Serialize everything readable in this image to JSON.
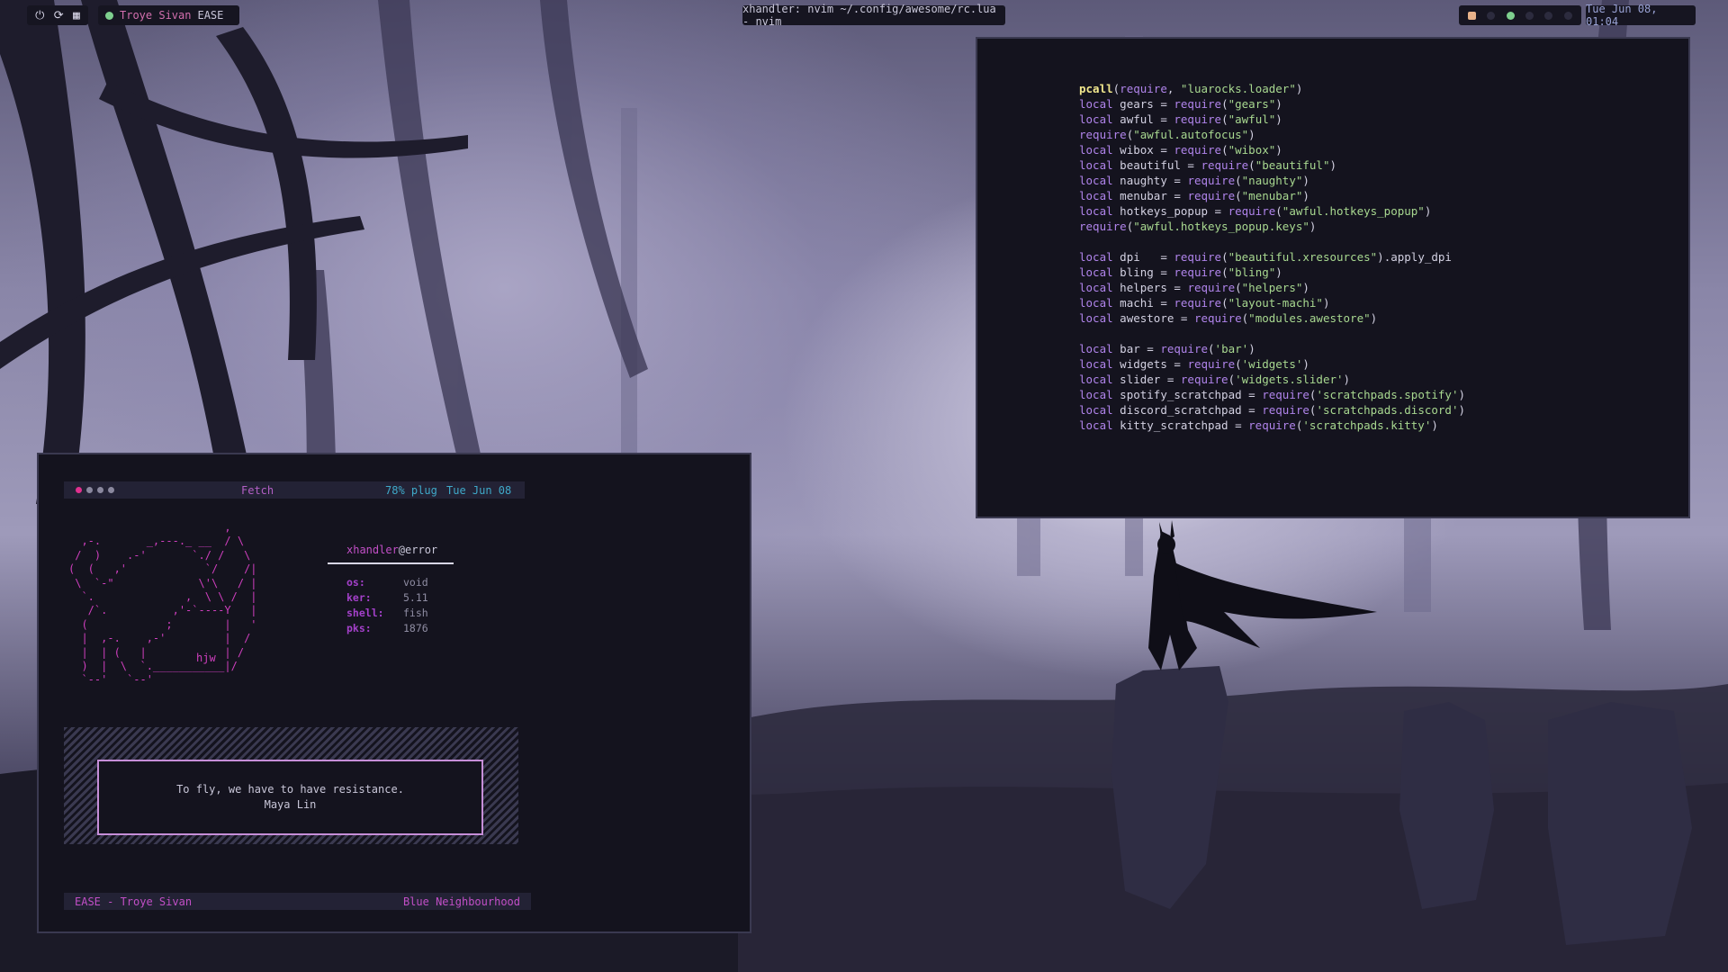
{
  "topbar": {
    "system_icons": [
      "power-icon",
      "reload-icon",
      "layout-icon"
    ],
    "music": {
      "title": "Troye Sivan",
      "song": "EASE"
    },
    "window_title": "xhandler: nvim ~/.config/awesome/rc.lua - nvim",
    "tray_icons": [
      "ghost-icon",
      "dot-icon",
      "spotify-icon",
      "dot-icon",
      "dot-icon",
      "dot-icon"
    ],
    "clock": "Tue Jun 08, 01:04"
  },
  "editor": {
    "lines": [
      [
        [
          "fn",
          "pcall"
        ],
        [
          "id",
          "("
        ],
        [
          "kw",
          "require"
        ],
        [
          "id",
          ", "
        ],
        [
          "str",
          "\"luarocks.loader\""
        ],
        [
          "id",
          ")"
        ]
      ],
      [
        [
          "kw",
          "local"
        ],
        [
          "id",
          " gears = "
        ],
        [
          "kw",
          "require"
        ],
        [
          "id",
          "("
        ],
        [
          "str",
          "\"gears\""
        ],
        [
          "id",
          ")"
        ]
      ],
      [
        [
          "kw",
          "local"
        ],
        [
          "id",
          " awful = "
        ],
        [
          "kw",
          "require"
        ],
        [
          "id",
          "("
        ],
        [
          "str",
          "\"awful\""
        ],
        [
          "id",
          ")"
        ]
      ],
      [
        [
          "kw",
          "require"
        ],
        [
          "id",
          "("
        ],
        [
          "str",
          "\"awful.autofocus\""
        ],
        [
          "id",
          ")"
        ]
      ],
      [
        [
          "kw",
          "local"
        ],
        [
          "id",
          " wibox = "
        ],
        [
          "kw",
          "require"
        ],
        [
          "id",
          "("
        ],
        [
          "str",
          "\"wibox\""
        ],
        [
          "id",
          ")"
        ]
      ],
      [
        [
          "kw",
          "local"
        ],
        [
          "id",
          " beautiful = "
        ],
        [
          "kw",
          "require"
        ],
        [
          "id",
          "("
        ],
        [
          "str",
          "\"beautiful\""
        ],
        [
          "id",
          ")"
        ]
      ],
      [
        [
          "kw",
          "local"
        ],
        [
          "id",
          " naughty = "
        ],
        [
          "kw",
          "require"
        ],
        [
          "id",
          "("
        ],
        [
          "str",
          "\"naughty\""
        ],
        [
          "id",
          ")"
        ]
      ],
      [
        [
          "kw",
          "local"
        ],
        [
          "id",
          " menubar = "
        ],
        [
          "kw",
          "require"
        ],
        [
          "id",
          "("
        ],
        [
          "str",
          "\"menubar\""
        ],
        [
          "id",
          ")"
        ]
      ],
      [
        [
          "kw",
          "local"
        ],
        [
          "id",
          " hotkeys_popup = "
        ],
        [
          "kw",
          "require"
        ],
        [
          "id",
          "("
        ],
        [
          "str",
          "\"awful.hotkeys_popup\""
        ],
        [
          "id",
          ")"
        ]
      ],
      [
        [
          "kw",
          "require"
        ],
        [
          "id",
          "("
        ],
        [
          "str",
          "\"awful.hotkeys_popup.keys\""
        ],
        [
          "id",
          ")"
        ]
      ],
      [],
      [
        [
          "kw",
          "local"
        ],
        [
          "id",
          " dpi   = "
        ],
        [
          "kw",
          "require"
        ],
        [
          "id",
          "("
        ],
        [
          "str",
          "\"beautiful.xresources\""
        ],
        [
          "id",
          ").apply_dpi"
        ]
      ],
      [
        [
          "kw",
          "local"
        ],
        [
          "id",
          " bling = "
        ],
        [
          "kw",
          "require"
        ],
        [
          "id",
          "("
        ],
        [
          "str",
          "\"bling\""
        ],
        [
          "id",
          ")"
        ]
      ],
      [
        [
          "kw",
          "local"
        ],
        [
          "id",
          " helpers = "
        ],
        [
          "kw",
          "require"
        ],
        [
          "id",
          "("
        ],
        [
          "str",
          "\"helpers\""
        ],
        [
          "id",
          ")"
        ]
      ],
      [
        [
          "kw",
          "local"
        ],
        [
          "id",
          " machi = "
        ],
        [
          "kw",
          "require"
        ],
        [
          "id",
          "("
        ],
        [
          "str",
          "\"layout-machi\""
        ],
        [
          "id",
          ")"
        ]
      ],
      [
        [
          "kw",
          "local"
        ],
        [
          "id",
          " awestore = "
        ],
        [
          "kw",
          "require"
        ],
        [
          "id",
          "("
        ],
        [
          "str",
          "\"modules.awestore\""
        ],
        [
          "id",
          ")"
        ]
      ],
      [],
      [
        [
          "kw",
          "local"
        ],
        [
          "id",
          " bar = "
        ],
        [
          "kw",
          "require"
        ],
        [
          "id",
          "("
        ],
        [
          "str",
          "'bar'"
        ],
        [
          "id",
          ")"
        ]
      ],
      [
        [
          "kw",
          "local"
        ],
        [
          "id",
          " widgets = "
        ],
        [
          "kw",
          "require"
        ],
        [
          "id",
          "("
        ],
        [
          "str",
          "'widgets'"
        ],
        [
          "id",
          ")"
        ]
      ],
      [
        [
          "kw",
          "local"
        ],
        [
          "id",
          " slider = "
        ],
        [
          "kw",
          "require"
        ],
        [
          "id",
          "("
        ],
        [
          "str",
          "'widgets.slider'"
        ],
        [
          "id",
          ")"
        ]
      ],
      [
        [
          "kw",
          "local"
        ],
        [
          "id",
          " spotify_scratchpad = "
        ],
        [
          "kw",
          "require"
        ],
        [
          "id",
          "("
        ],
        [
          "str",
          "'scratchpads.spotify'"
        ],
        [
          "id",
          ")"
        ]
      ],
      [
        [
          "kw",
          "local"
        ],
        [
          "id",
          " discord_scratchpad = "
        ],
        [
          "kw",
          "require"
        ],
        [
          "id",
          "("
        ],
        [
          "str",
          "'scratchpads.discord'"
        ],
        [
          "id",
          ")"
        ]
      ],
      [
        [
          "kw",
          "local"
        ],
        [
          "id",
          " kitty_scratchpad = "
        ],
        [
          "kw",
          "require"
        ],
        [
          "id",
          "("
        ],
        [
          "str",
          "'scratchpads.kitty'"
        ],
        [
          "id",
          ")"
        ]
      ]
    ]
  },
  "fetch": {
    "tab": "Fetch",
    "plug": "78% plug",
    "date": "Tue Jun 08",
    "ascii_art": "                        ,\n  ,-.       _,---._ __  / \\\n /  )    .-'       `./ /   \\\n(  (   ,'            `/    /|\n \\  `-\"             \\'\\   / |\n  `.              ,  \\ \\ /  |\n   /`.          ,'-`----Y   |\n  (            ;        |   '\n  |  ,-.    ,-'         |  /\n  |  | (   |            | /\n  )  |  \\  `.___________|/\n  `--'   `--'",
    "ascii_signature": "hjw",
    "user": "xhandler",
    "host": "@error",
    "info": [
      {
        "key": "os:",
        "value": "void"
      },
      {
        "key": "ker:",
        "value": "5.11"
      },
      {
        "key": "shell:",
        "value": "fish"
      },
      {
        "key": "pks:",
        "value": "1876"
      }
    ],
    "quote": {
      "text": "To fly, we have to have resistance.",
      "author": "Maya Lin"
    },
    "footer": {
      "track": "EASE - Troye Sivan",
      "album": "Blue Neighbourhood"
    }
  }
}
